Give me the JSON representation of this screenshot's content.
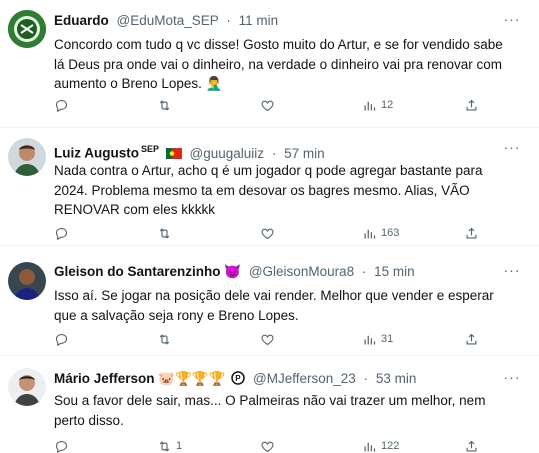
{
  "tweets": [
    {
      "name": "Eduardo",
      "handle": "@EduMota_SEP",
      "dot": "·",
      "time": "11 min",
      "text": "Concordo com tudo q vc disse! Gosto muito do Artur, e se for vendido sabe lá Deus pra onde vai o dinheiro, na verdade o dinheiro vai pra renovar com aumento o Breno Lopes. 🤦‍♂️",
      "replies": "",
      "retweets": "",
      "likes": "",
      "views": "12"
    },
    {
      "name": "Luiz Augusto",
      "name_suffix": "SEP",
      "handle": "@guugaluiiz",
      "dot": "·",
      "time": "57 min",
      "text": "Nada contra o Artur, acho q é um jogador q pode agregar bastante para 2024. Problema mesmo ta em desovar os bagres mesmo. Alias, VÃO RENOVAR com eles kkkkk",
      "replies": "",
      "retweets": "",
      "likes": "",
      "views": "163"
    },
    {
      "name": "Gleison do Santarenzinho 😈",
      "handle": "@GleisonMoura8",
      "dot": "·",
      "time": "15 min",
      "text": "Isso aí. Se jogar na posição dele  vai render.  Melhor que vender e esperar que a salvação seja rony e Breno Lopes.",
      "replies": "",
      "retweets": "",
      "likes": "",
      "views": "31"
    },
    {
      "name": "Mário Jefferson 🐷🏆🏆🏆",
      "handle": "@MJefferson_23",
      "dot": "·",
      "time": "53 min",
      "text": "Sou a favor dele sair, mas... O Palmeiras não vai trazer um melhor, nem perto disso.",
      "replies": "",
      "retweets": "1",
      "likes": "",
      "views": "122"
    }
  ],
  "colors": {
    "text": "#0f1419",
    "muted": "#536471",
    "border": "#eff3f4"
  },
  "icons": [
    "reply-icon",
    "retweet-icon",
    "like-icon",
    "views-icon",
    "bookmark-share-icon",
    "more-icon",
    "portugal-flag-icon"
  ]
}
